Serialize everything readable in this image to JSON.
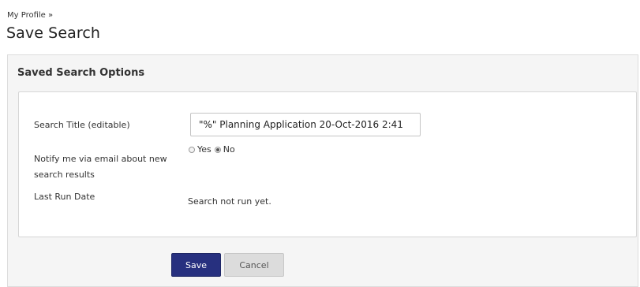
{
  "breadcrumb": {
    "parent": "My Profile",
    "separator": "»"
  },
  "page": {
    "title": "Save Search"
  },
  "panel": {
    "heading": "Saved Search Options"
  },
  "form": {
    "title_label": "Search Title (editable)",
    "title_value": "\"%\" Planning Application 20-Oct-2016 2:41",
    "notify_label": "Notify me via email about new search results",
    "notify_options": [
      {
        "label": "Yes",
        "checked": false
      },
      {
        "label": "No",
        "checked": true
      }
    ],
    "last_run_label": "Last Run Date",
    "last_run_value": "Search not run yet."
  },
  "actions": {
    "save_label": "Save",
    "cancel_label": "Cancel"
  },
  "colors": {
    "save_button": "#27307f",
    "cancel_button": "#dcdcdc",
    "panel_bg": "#f5f5f5"
  }
}
